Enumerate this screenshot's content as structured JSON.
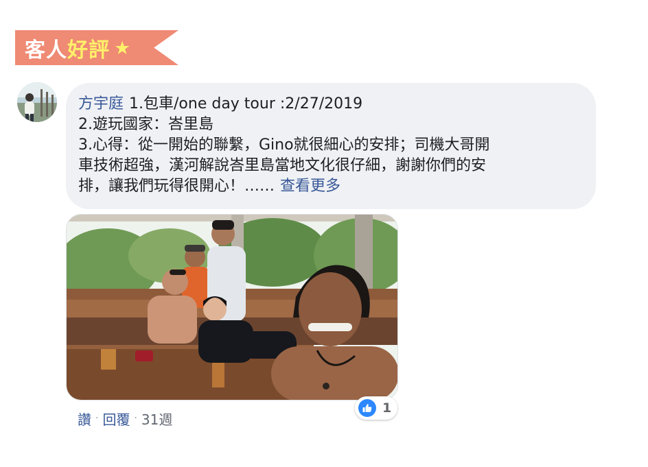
{
  "header": {
    "title_part1": "客人",
    "title_part2": "好評",
    "star": "★"
  },
  "comment": {
    "author": "方宇庭",
    "lines": [
      "1.包車/one day tour :2/27/2019",
      "2.遊玩國家：峇里島",
      "3.心得：從一開始的聯繫，Gino就很細心的安排；司機大哥開",
      "車技術超強，漢河解說峇里島當地文化很仔細，謝謝你們的安",
      "排，讓我們玩得很開心！……"
    ],
    "see_more": "查看更多",
    "photo_icon": "group-photo"
  },
  "reaction": {
    "icon": "like-icon",
    "count": "1",
    "color": "#2d88ff"
  },
  "actions": {
    "like": "讚",
    "reply": "回覆",
    "separator": "·",
    "time": "31週"
  },
  "colors": {
    "ribbon": "#ef8a74",
    "ribbon_highlight": "#fff06a",
    "bubble": "#eff1f4",
    "link": "#385898"
  }
}
